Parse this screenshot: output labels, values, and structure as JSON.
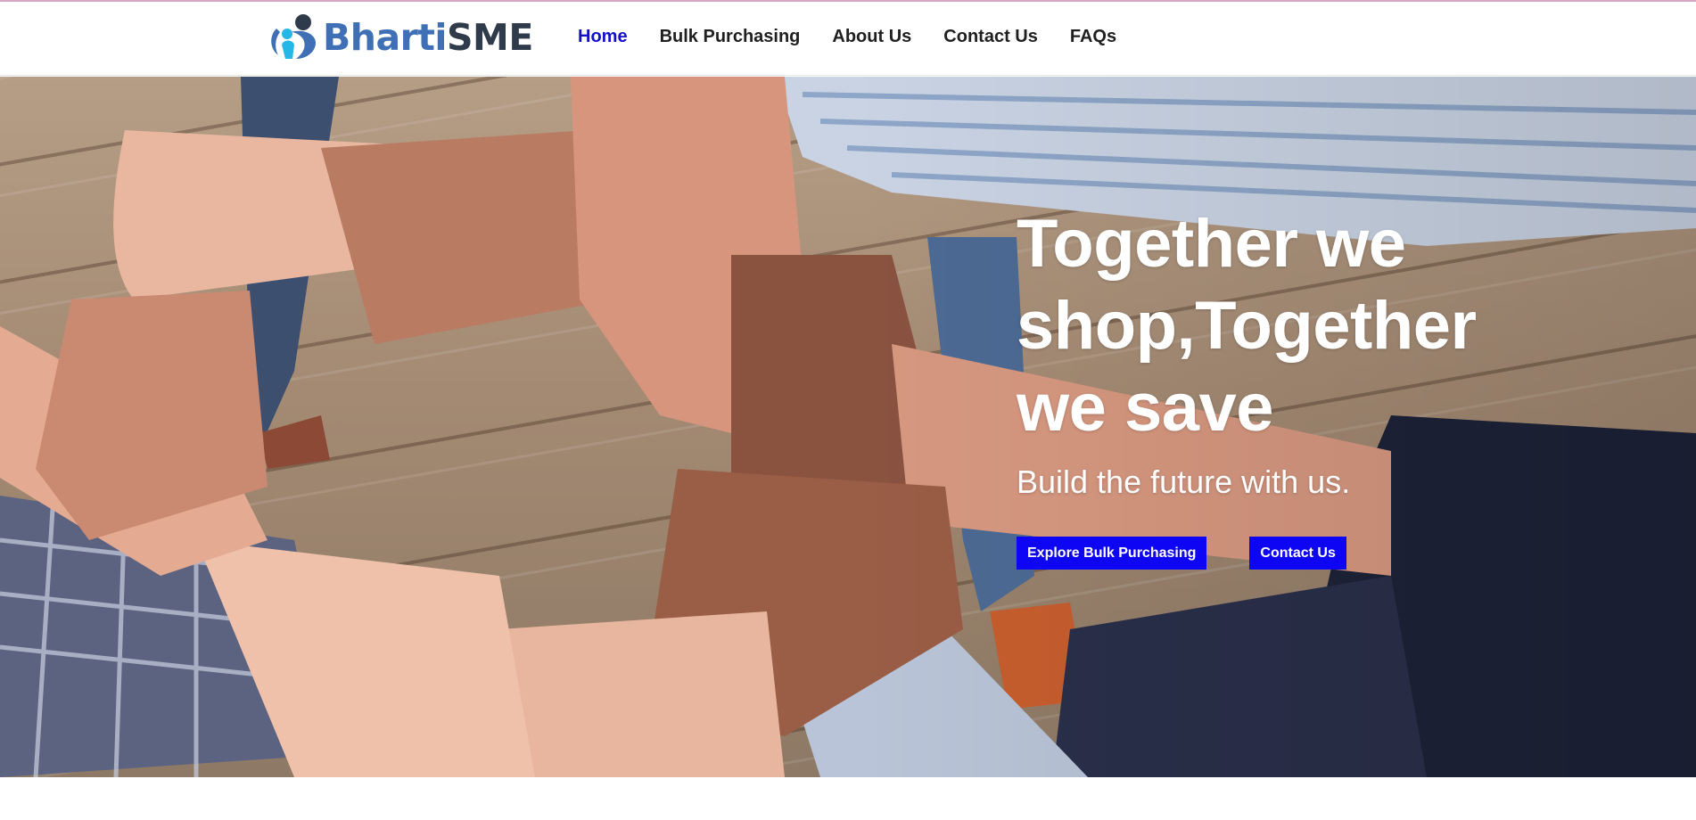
{
  "brand": {
    "name_part1": "Bharti",
    "name_part2": "SME",
    "logo_icon": "people-circle-logo-icon",
    "colors": {
      "primary": "#3f6fb5",
      "dark": "#2f3a4a",
      "accent": "#27b7e6"
    }
  },
  "nav": {
    "items": [
      {
        "label": "Home",
        "active": true
      },
      {
        "label": "Bulk Purchasing",
        "active": false
      },
      {
        "label": "About Us",
        "active": false
      },
      {
        "label": "Contact Us",
        "active": false
      },
      {
        "label": "FAQs",
        "active": false
      }
    ],
    "active_color": "#1410c8"
  },
  "hero": {
    "title_lines": [
      "Together we",
      "shop,Together",
      "we save"
    ],
    "subtitle": "Build the future with us.",
    "buttons": [
      {
        "label": "Explore Bulk Purchasing"
      },
      {
        "label": "Contact Us"
      }
    ],
    "button_color": "#0f05f5",
    "image_subject": "hands-holding-wrists-circle-photo"
  }
}
